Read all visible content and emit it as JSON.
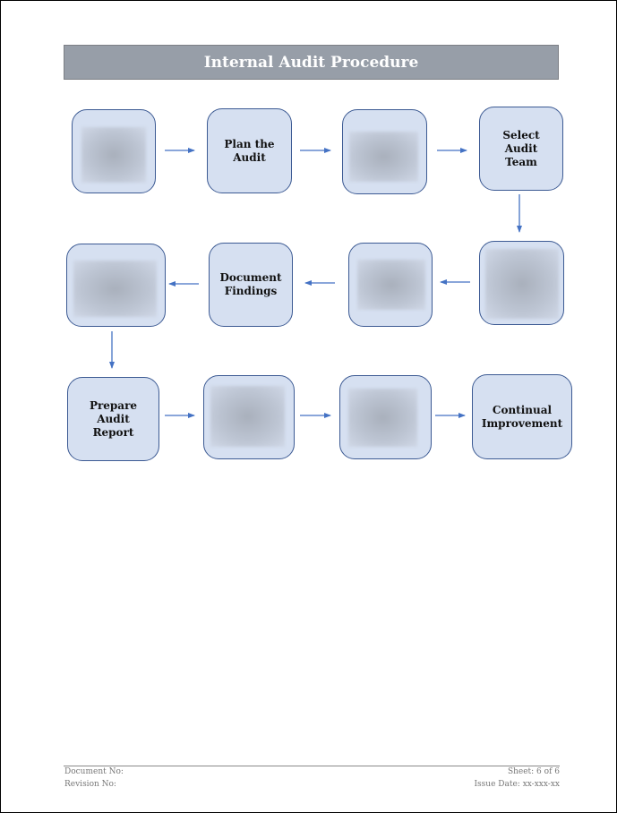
{
  "title": "Internal Audit Procedure",
  "flow": {
    "row1": [
      {
        "label": "",
        "redacted": true
      },
      {
        "label": "Plan the Audit",
        "redacted": false
      },
      {
        "label": "",
        "redacted": true
      },
      {
        "label": "Select Audit Team",
        "redacted": false
      }
    ],
    "row2": [
      {
        "label": "",
        "redacted": true
      },
      {
        "label": "Document Findings",
        "redacted": false
      },
      {
        "label": "",
        "redacted": true
      },
      {
        "label": "",
        "redacted": true
      }
    ],
    "row3": [
      {
        "label": "Prepare Audit Report",
        "redacted": false
      },
      {
        "label": "",
        "redacted": true
      },
      {
        "label": "",
        "redacted": true
      },
      {
        "label": "Continual Improvement",
        "redacted": false
      }
    ]
  },
  "colors": {
    "box_fill": "#d6e0f1",
    "box_border": "#3c5a93",
    "arrow": "#4472c4",
    "title_bar": "#979ea8"
  },
  "footer": {
    "document_no": "Document No:",
    "revision_no": "Revision No:",
    "sheet": "Sheet: 6 of 6",
    "issue_date": "Issue Date: xx-xxx-xx"
  }
}
